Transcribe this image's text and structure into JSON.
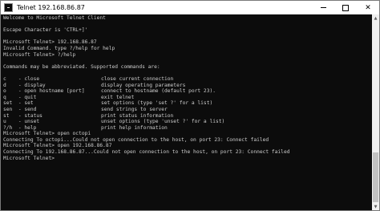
{
  "window": {
    "title": "Telnet 192.168.86.87"
  },
  "console": {
    "lines_before": [
      "Welcome to Microsoft Telnet Client",
      "",
      "Escape Character is 'CTRL+]'",
      "",
      "Microsoft Telnet> 192.168.86.87",
      "Invalid Command. type ?/help for help",
      "Microsoft Telnet> ?/help",
      "",
      "Commands may be abbreviated. Supported commands are:",
      ""
    ],
    "commands": [
      {
        "name": "c    - close",
        "desc": "close current connection"
      },
      {
        "name": "d    - display",
        "desc": "display operating parameters"
      },
      {
        "name": "o    - open hostname [port]",
        "desc": "connect to hostname (default port 23)."
      },
      {
        "name": "q    - quit",
        "desc": "exit telnet"
      },
      {
        "name": "set  - set",
        "desc": "set options (type 'set ?' for a list)"
      },
      {
        "name": "sen  - send",
        "desc": "send strings to server"
      },
      {
        "name": "st   - status",
        "desc": "print status information"
      },
      {
        "name": "u    - unset",
        "desc": "unset options (type 'unset ?' for a list)"
      },
      {
        "name": "?/h  - help",
        "desc": "print help information"
      }
    ],
    "lines_after": [
      "Microsoft Telnet> open octopi",
      "Connecting To octopi...Could not open connection to the host, on port 23: Connect failed",
      "Microsoft Telnet> open 192.168.86.87",
      "Connecting To 192.168.86.87...Could not open connection to the host, on port 23: Connect failed",
      "Microsoft Telnet>"
    ]
  }
}
